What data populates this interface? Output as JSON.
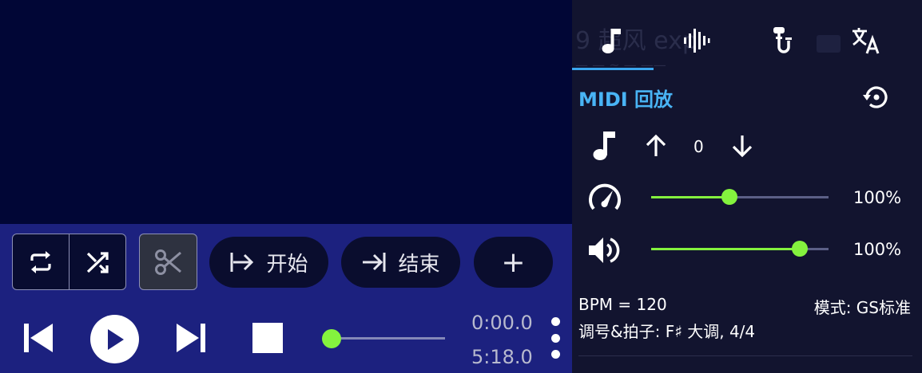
{
  "player": {
    "start_label": "开始",
    "end_label": "结束",
    "add_label": "+",
    "time_current": "0:00.0",
    "time_total": "5:18.0",
    "progress_fraction": 0.0
  },
  "icons": {
    "repeat": "repeat-icon",
    "shuffle": "shuffle-icon",
    "scissors": "scissors-icon",
    "start_marker": "set-start-icon",
    "end_marker": "set-end-icon",
    "prev": "skip-previous-icon",
    "play": "play-icon",
    "next": "skip-next-icon",
    "stop": "stop-icon",
    "more": "more-vertical-icon",
    "tab_midi": "music-note-icon",
    "tab_wave": "waveform-icon",
    "tab_vocal": "microphone-icon",
    "tab_translate": "translate-icon",
    "reset": "reset-icon",
    "pitch_up": "arrow-up-icon",
    "pitch_down": "arrow-down-icon",
    "speed": "speedometer-icon",
    "volume": "volume-icon"
  },
  "panel": {
    "ghost_title": "9 超风 exp",
    "ghost_subtitle": "— — ~ — ——",
    "title": "MIDI 回放",
    "pitch_value": "0",
    "speed_pct": "100%",
    "speed_fraction": 0.44,
    "volume_pct": "100%",
    "volume_fraction": 0.84,
    "bpm": "BPM = 120",
    "mode": "模式: GS标准",
    "key_signature": "调号&拍子: F♯ 大调, 4/4"
  },
  "colors": {
    "accent_green": "#84f23e",
    "accent_blue": "#49b4f5",
    "control_bar": "#1c217f",
    "video_bg": "#010636",
    "panel_bg": "#12142f"
  }
}
